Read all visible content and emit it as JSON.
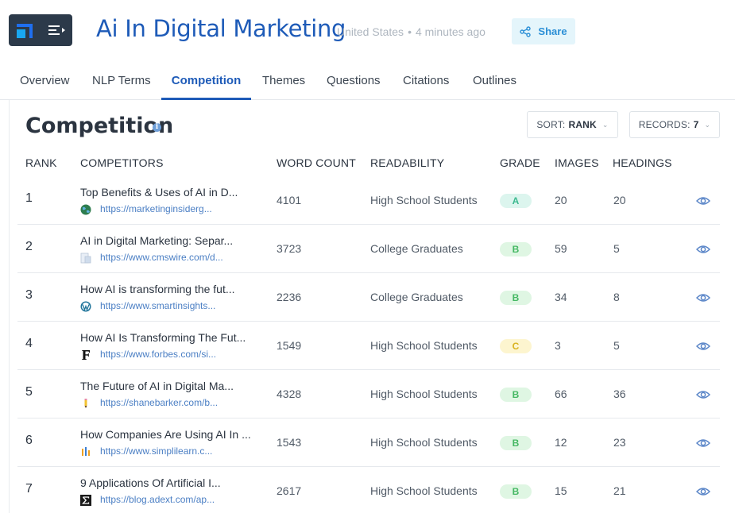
{
  "header": {
    "title": "Ai In Digital Marketing",
    "region": "United States",
    "separator": "•",
    "updated": "4 minutes ago",
    "share_label": "Share"
  },
  "tabs": [
    {
      "label": "Overview",
      "active": false
    },
    {
      "label": "NLP Terms",
      "active": false
    },
    {
      "label": "Competition",
      "active": true
    },
    {
      "label": "Themes",
      "active": false
    },
    {
      "label": "Questions",
      "active": false
    },
    {
      "label": "Citations",
      "active": false
    },
    {
      "label": "Outlines",
      "active": false
    }
  ],
  "section": {
    "title": "Competition",
    "info_icon": "info-icon",
    "sort_label": "SORT:",
    "sort_value": "RANK",
    "records_label": "RECORDS:",
    "records_value": "7"
  },
  "table": {
    "headers": [
      "RANK",
      "COMPETITORS",
      "WORD COUNT",
      "READABILITY",
      "GRADE",
      "IMAGES",
      "HEADINGS"
    ],
    "rows": [
      {
        "rank": "1",
        "title": "Top Benefits & Uses of AI in D...",
        "url": "https://marketinginsiderg...",
        "favicon": "globe-icon",
        "word_count": "4101",
        "readability": "High School Students",
        "grade": "A",
        "images": "20",
        "headings": "20"
      },
      {
        "rank": "2",
        "title": "AI in Digital Marketing: Separ...",
        "url": "https://www.cmswire.com/d...",
        "favicon": "document-icon",
        "word_count": "3723",
        "readability": "College Graduates",
        "grade": "B",
        "images": "59",
        "headings": "5"
      },
      {
        "rank": "3",
        "title": "How AI is transforming the fut...",
        "url": "https://www.smartinsights...",
        "favicon": "wordpress-icon",
        "word_count": "2236",
        "readability": "College Graduates",
        "grade": "B",
        "images": "34",
        "headings": "8"
      },
      {
        "rank": "4",
        "title": "How AI Is Transforming The Fut...",
        "url": "https://www.forbes.com/si...",
        "favicon": "forbes-f-icon",
        "word_count": "1549",
        "readability": "High School Students",
        "grade": "C",
        "images": "3",
        "headings": "5"
      },
      {
        "rank": "5",
        "title": "The Future of AI in Digital Ma...",
        "url": "https://shanebarker.com/b...",
        "favicon": "pencil-icon",
        "word_count": "4328",
        "readability": "High School Students",
        "grade": "B",
        "images": "66",
        "headings": "36"
      },
      {
        "rank": "6",
        "title": "How Companies Are Using AI In ...",
        "url": "https://www.simplilearn.c...",
        "favicon": "bars-icon",
        "word_count": "1543",
        "readability": "High School Students",
        "grade": "B",
        "images": "12",
        "headings": "23"
      },
      {
        "rank": "7",
        "title": "9 Applications Of Artificial I...",
        "url": "https://blog.adext.com/ap...",
        "favicon": "sigma-icon",
        "word_count": "2617",
        "readability": "High School Students",
        "grade": "B",
        "images": "15",
        "headings": "21"
      }
    ]
  },
  "colors": {
    "brand": "#1e5bb8",
    "link": "#4b7fc4",
    "grade_a": "#3cb98f",
    "grade_b": "#45b863",
    "grade_c": "#d9b320"
  }
}
